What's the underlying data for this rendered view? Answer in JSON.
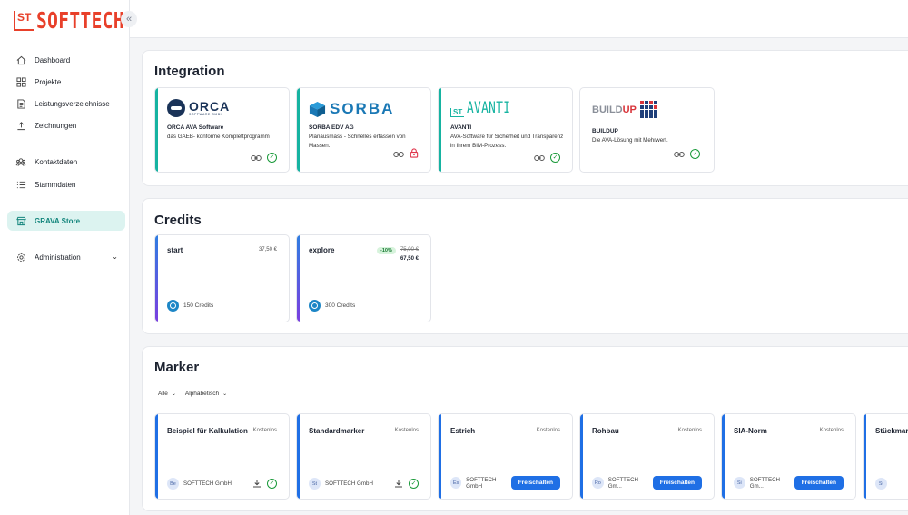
{
  "app": {
    "logo_mark": "ST",
    "logo_text": "SOFTTECH",
    "collapse": "«"
  },
  "sidebar": {
    "items": [
      {
        "label": "Dashboard",
        "icon": "home-icon"
      },
      {
        "label": "Projekte",
        "icon": "grid-icon"
      },
      {
        "label": "Leistungsverzeichnisse",
        "icon": "document-icon"
      },
      {
        "label": "Zeichnungen",
        "icon": "upload-icon"
      },
      {
        "label": "Kontaktdaten",
        "icon": "users-icon"
      },
      {
        "label": "Stammdaten",
        "icon": "list-icon"
      },
      {
        "label": "GRAVA Store",
        "icon": "store-icon",
        "active": true
      },
      {
        "label": "Administration",
        "icon": "gear-icon"
      }
    ]
  },
  "integration": {
    "title": "Integration",
    "cards": [
      {
        "logo": "ORCA",
        "logo_sub": "SOFTWARE GMBH",
        "name": "ORCA AVA Software",
        "desc": "das GAEB- konforme Komplettprogramm",
        "status": "connected"
      },
      {
        "logo": "SORBA",
        "name": "SORBA EDV AG",
        "desc": "Planausmass - Schnelles erfassen von Massen.",
        "status": "locked"
      },
      {
        "logo": "AVANTI",
        "logo_mark": "ST",
        "name": "AVANTI",
        "desc": "AVA-Software für Sicherheit und Transparenz in Ihrem BIM-Prozess.",
        "status": "connected"
      },
      {
        "logo_a": "BUILD",
        "logo_b": "UP",
        "name": "BUILDUP",
        "desc": "Die AVA-Lösung mit Mehrwert.",
        "status": "connected"
      }
    ]
  },
  "credits": {
    "title": "Credits",
    "cards": [
      {
        "name": "start",
        "price": "37,50 €",
        "credits": "150 Credits"
      },
      {
        "name": "explore",
        "badge": "-10%",
        "old_price": "75,00 €",
        "price": "67,50 €",
        "credits": "300 Credits"
      }
    ]
  },
  "marker": {
    "title": "Marker",
    "filter_all": "Alle",
    "filter_sort": "Alphabetisch",
    "cards": [
      {
        "title": "Beispiel für Kalkulation",
        "price": "Kostenlos",
        "avatar": "Be",
        "owner": "SOFTTECH GmbH",
        "action": "installed"
      },
      {
        "title": "Standardmarker",
        "price": "Kostenlos",
        "avatar": "St",
        "owner": "SOFTTECH GmbH",
        "action": "installed"
      },
      {
        "title": "Estrich",
        "price": "Kostenlos",
        "avatar": "Es",
        "owner": "SOFTTECH GmbH",
        "action": "unlock",
        "button": "Freischalten"
      },
      {
        "title": "Rohbau",
        "price": "Kostenlos",
        "avatar": "Ro",
        "owner": "SOFTTECH Gm...",
        "action": "unlock",
        "button": "Freischalten"
      },
      {
        "title": "SIA-Norm",
        "price": "Kostenlos",
        "avatar": "Si",
        "owner": "SOFTTECH Gm...",
        "action": "unlock",
        "button": "Freischalten"
      },
      {
        "title": "Stückmar",
        "price": "",
        "avatar": "St",
        "owner": "",
        "action": "none"
      }
    ]
  },
  "colors": {
    "brand": "#e8402a",
    "accent_teal": "#16b3a1",
    "primary_blue": "#1f6fe5",
    "success": "#1a9a3a",
    "danger": "#e0344a"
  }
}
